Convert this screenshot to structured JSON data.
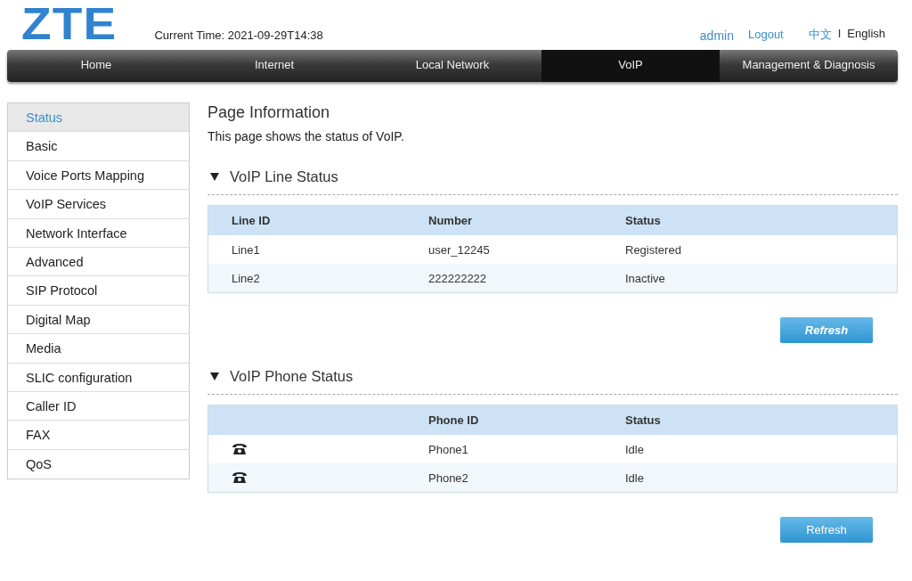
{
  "header": {
    "logo": "ZTE",
    "current_time": "Current Time: 2021-09-29T14:38",
    "user": "admin",
    "logout": "Logout",
    "languages": [
      {
        "label": "中文",
        "selected": false
      },
      {
        "label": "English",
        "selected": true
      }
    ],
    "language_separator": "I"
  },
  "nav": [
    {
      "label": "Home",
      "selected": false
    },
    {
      "label": "Internet",
      "selected": false
    },
    {
      "label": "Local Network",
      "selected": false
    },
    {
      "label": "VoIP",
      "selected": true
    },
    {
      "label": "Management & Diagnosis",
      "selected": false
    }
  ],
  "sidebar": {
    "items": [
      {
        "label": "Status",
        "selected": true
      },
      {
        "label": "Basic",
        "selected": false
      },
      {
        "label": "Voice Ports Mapping",
        "selected": false
      },
      {
        "label": "VoIP Services",
        "selected": false
      },
      {
        "label": "Network Interface",
        "selected": false
      },
      {
        "label": "Advanced",
        "selected": false
      },
      {
        "label": "SIP Protocol",
        "selected": false
      },
      {
        "label": "Digital Map",
        "selected": false
      },
      {
        "label": "Media",
        "selected": false
      },
      {
        "label": "SLIC configuration",
        "selected": false
      },
      {
        "label": "Caller ID",
        "selected": false
      },
      {
        "label": "FAX",
        "selected": false
      },
      {
        "label": "QoS",
        "selected": false
      }
    ]
  },
  "page": {
    "title": "Page Information",
    "description": "This page shows the status of VoIP."
  },
  "sections": [
    {
      "title": "VoIP Line Status",
      "expanded": true,
      "columns": [
        "Line ID",
        "Number",
        "Status"
      ],
      "rows": [
        [
          "Line1",
          "user_12245",
          "Registered"
        ],
        [
          "Line2",
          "222222222",
          "Inactive"
        ]
      ],
      "button": {
        "label": "Refresh",
        "emphasized": true
      }
    },
    {
      "title": "VoIP Phone Status",
      "expanded": true,
      "columns": [
        "",
        "Phone ID",
        "Status"
      ],
      "rows": [
        [
          {
            "kind": "phone"
          },
          "Phone1",
          "Idle"
        ],
        [
          {
            "kind": "phone"
          },
          "Phone2",
          "Idle"
        ]
      ],
      "button": {
        "label": "Refresh",
        "emphasized": false
      }
    }
  ]
}
